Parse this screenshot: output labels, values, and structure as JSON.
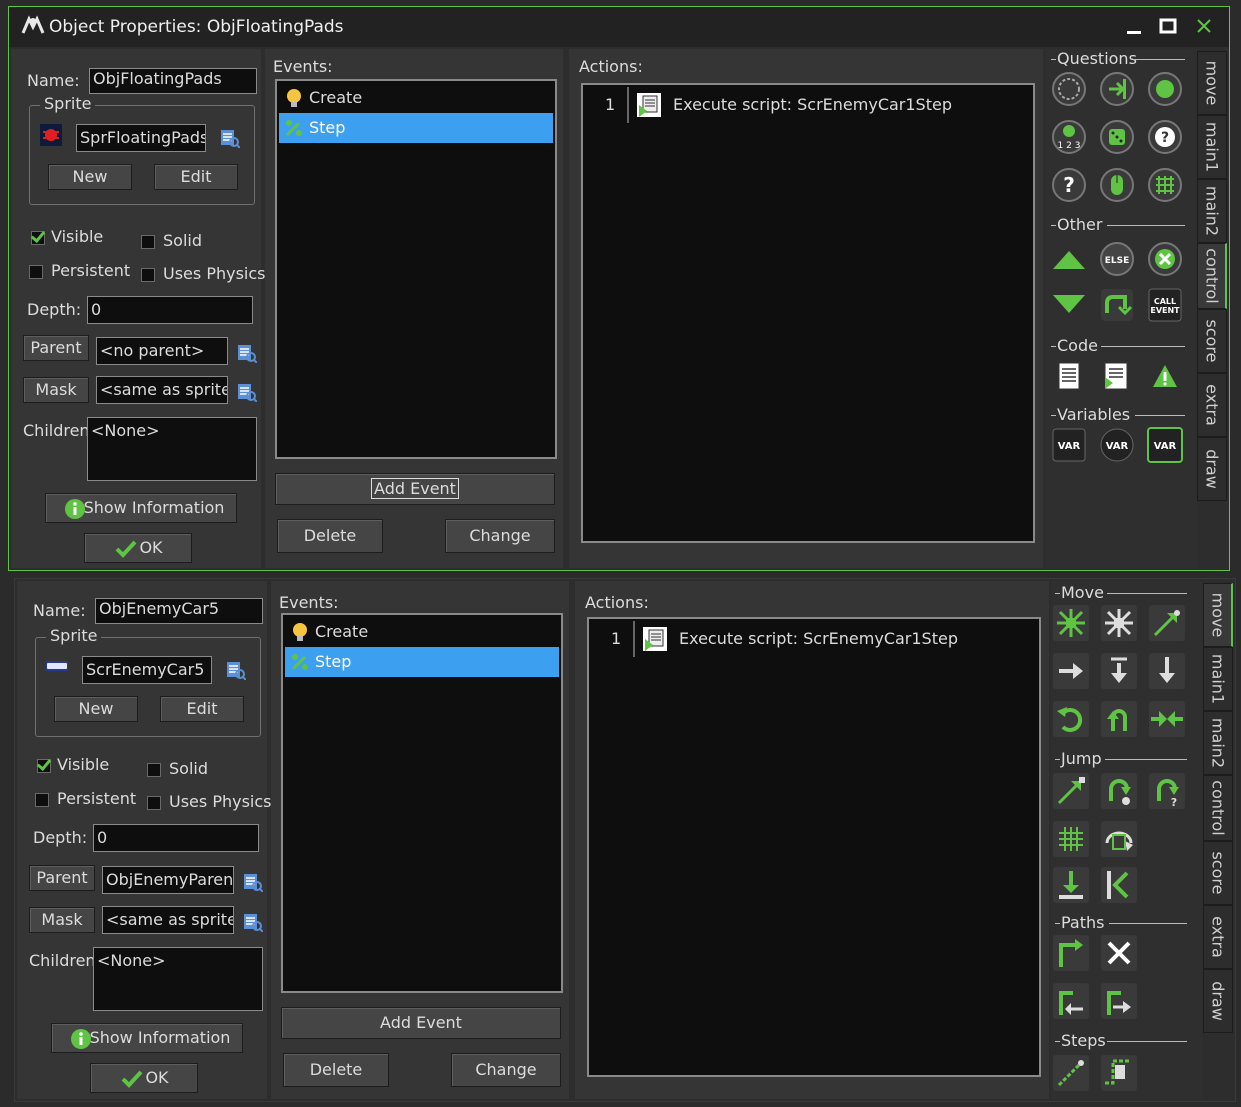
{
  "window": {
    "title": "Object Properties: ObjFloatingPads"
  },
  "colors": {
    "accent": "#5fc443",
    "selection": "#3d9ff0",
    "background": "#2d2d2d"
  },
  "icon_names": [
    "app-logo-icon",
    "minimize-icon",
    "maximize-icon",
    "close-icon",
    "bulb-icon",
    "step-icon",
    "script-icon",
    "browse-icon",
    "info-icon",
    "check-icon"
  ],
  "labels": {
    "name": "Name:",
    "sprite": "Sprite",
    "new": "New",
    "edit": "Edit",
    "visible": "Visible",
    "solid": "Solid",
    "persistent": "Persistent",
    "uses_physics": "Uses Physics",
    "depth": "Depth:",
    "parent": "Parent",
    "mask": "Mask",
    "children": "Children:",
    "show_information": "Show Information",
    "ok": "OK",
    "events": "Events:",
    "actions": "Actions:",
    "add_event": "Add Event",
    "delete": "Delete",
    "change": "Change"
  },
  "tabs": [
    "move",
    "main1",
    "main2",
    "control",
    "score",
    "extra",
    "draw"
  ],
  "top": {
    "name": "ObjFloatingPads",
    "sprite": "SprFloatingPads",
    "visible": true,
    "solid": false,
    "persistent": false,
    "uses_physics": false,
    "depth": "0",
    "parent": "<no parent>",
    "mask": "<same as sprite>",
    "children": "<None>",
    "events": [
      {
        "label": "Create",
        "icon": "bulb-icon",
        "selected": false
      },
      {
        "label": "Step",
        "icon": "step-icon",
        "selected": true
      }
    ],
    "actions": [
      {
        "num": "1",
        "text": "Execute script: ScrEnemyCar1Step"
      }
    ],
    "active_tab": "control",
    "sections": {
      "questions": "Questions",
      "other": "Other",
      "code": "Code",
      "variables": "Variables"
    },
    "palette_text": {
      "else": "ELSE",
      "call": "CALL",
      "event": "EVENT",
      "var": "VAR",
      "q_icon": "?",
      "digits": "1 2 3"
    }
  },
  "bottom": {
    "name": "ObjEnemyCar5",
    "sprite": "ScrEnemyCar5",
    "visible": true,
    "solid": false,
    "persistent": false,
    "uses_physics": false,
    "depth": "0",
    "parent": "ObjEnemyParent",
    "mask": "<same as sprite>",
    "children": "<None>",
    "events": [
      {
        "label": "Create",
        "icon": "bulb-icon",
        "selected": false
      },
      {
        "label": "Step",
        "icon": "step-icon",
        "selected": true
      }
    ],
    "actions": [
      {
        "num": "1",
        "text": "Execute script: ScrEnemyCar1Step"
      }
    ],
    "active_tab": "move",
    "sections": {
      "move": "Move",
      "jump": "Jump",
      "paths": "Paths",
      "steps": "Steps"
    }
  }
}
